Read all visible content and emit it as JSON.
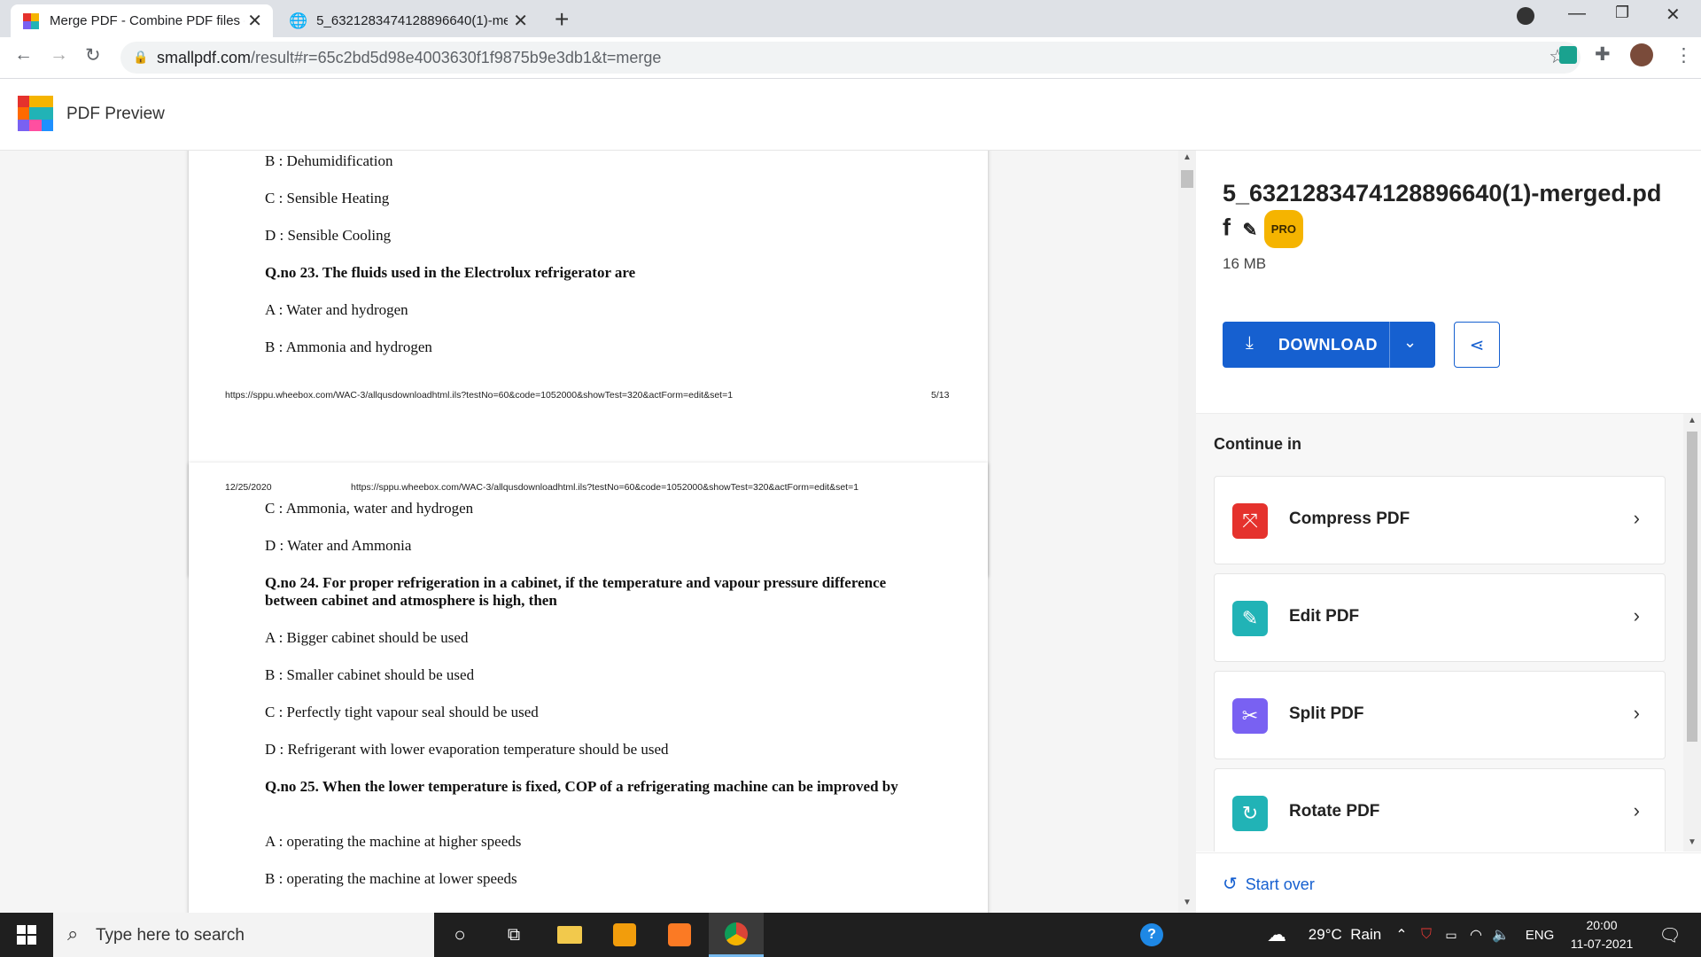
{
  "browser": {
    "tabs": [
      {
        "title": "Merge PDF - Combine PDF files online",
        "active": true
      },
      {
        "title": "5_6321283474128896640(1)-merged.pdf",
        "active": false
      }
    ],
    "url_domain": "smallpdf.com",
    "url_path": "/result#r=65c2bd5d98e4003630f1f9875b9e3db1&t=merge"
  },
  "app": {
    "title": "PDF Preview"
  },
  "pdf": {
    "page_a": {
      "lines": [
        "B : Dehumidification",
        "C : Sensible Heating",
        "D : Sensible Cooling",
        "Q.no 23. The fluids used in the Electrolux refrigerator are",
        "A : Water and hydrogen",
        "B : Ammonia and hydrogen"
      ],
      "footer_url": "https://sppu.wheebox.com/WAC-3/allqusdownloadhtml.ils?testNo=60&code=1052000&showTest=320&actForm=edit&set=1",
      "page_num": "5/13"
    },
    "page_b": {
      "header_date": "12/25/2020",
      "header_url": "https://sppu.wheebox.com/WAC-3/allqusdownloadhtml.ils?testNo=60&code=1052000&showTest=320&actForm=edit&set=1",
      "lines": [
        "C : Ammonia, water and hydrogen",
        "D : Water and Ammonia",
        "Q.no 24. For proper refrigeration in a cabinet, if the temperature and vapour pressure difference between cabinet and atmosphere is high, then",
        "A : Bigger cabinet should be used",
        "B : Smaller cabinet should be used",
        "C : Perfectly tight vapour seal should be used",
        "D : Refrigerant with lower evaporation temperature should be used",
        "Q.no 25. When the lower temperature is fixed, COP of a refrigerating machine can be improved by",
        "A : operating the machine at higher speeds",
        "B : operating the machine at lower speeds"
      ]
    }
  },
  "side": {
    "filename": "5_6321283474128896640(1)-merged.pdf",
    "pro_badge": "PRO",
    "size": "16 MB",
    "download_label": "DOWNLOAD",
    "continue_heading": "Continue in",
    "tools": [
      {
        "label": "Compress PDF",
        "color": "#e5322d"
      },
      {
        "label": "Edit PDF",
        "color": "#21b3b6"
      },
      {
        "label": "Split PDF",
        "color": "#7961f2"
      },
      {
        "label": "Rotate PDF",
        "color": "#21b3b6"
      }
    ],
    "start_over": "Start over"
  },
  "taskbar": {
    "search_placeholder": "Type here to search",
    "weather": "29°C  Rain",
    "lang": "ENG",
    "time": "20:00",
    "date": "11-07-2021"
  },
  "colors": {
    "accent": "#1660d0",
    "pro": "#f5b400"
  }
}
